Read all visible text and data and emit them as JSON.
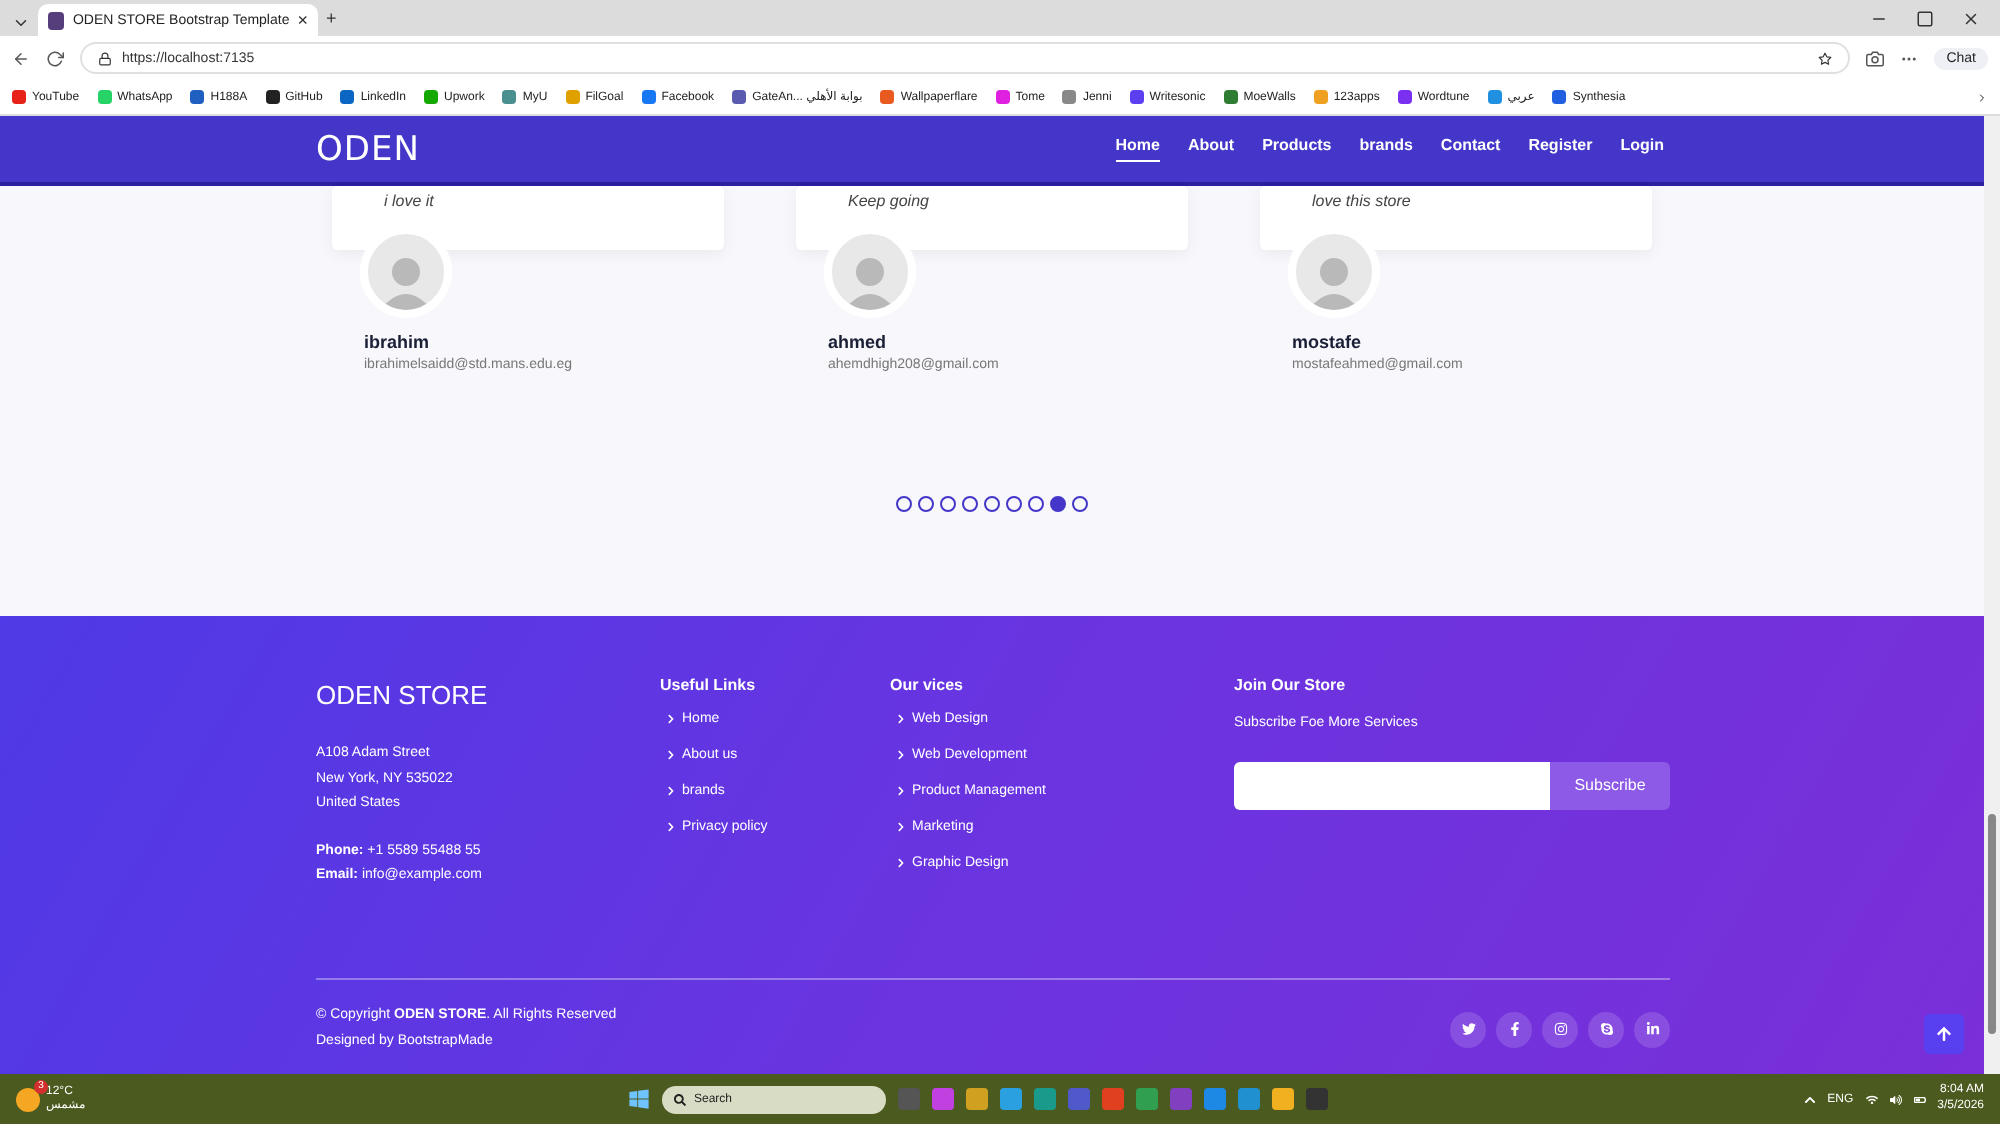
{
  "browser": {
    "tab": {
      "title": "ODEN STORE Bootstrap Template",
      "close": "×",
      "new_tab": "+"
    },
    "url": "https://localhost:7135",
    "chat": "Chat",
    "bookmarks": [
      {
        "label": "YouTube",
        "color": "#e62117"
      },
      {
        "label": "WhatsApp",
        "color": "#25d366"
      },
      {
        "label": "H188A",
        "color": "#1f5fbf"
      },
      {
        "label": "GitHub",
        "color": "#222222"
      },
      {
        "label": "LinkedIn",
        "color": "#0a66c2"
      },
      {
        "label": "Upwork",
        "color": "#14a800"
      },
      {
        "label": "MyU",
        "color": "#4a8f8f"
      },
      {
        "label": "FilGoal",
        "color": "#e0a000"
      },
      {
        "label": "Facebook",
        "color": "#1877f2"
      },
      {
        "label": "GateAn... بوابة الأهلي",
        "color": "#5a5ab0"
      },
      {
        "label": "Wallpaperflare",
        "color": "#e85a20"
      },
      {
        "label": "Tome",
        "color": "#e020e0"
      },
      {
        "label": "Jenni",
        "color": "#888888"
      },
      {
        "label": "Writesonic",
        "color": "#5b3ff0"
      },
      {
        "label": "MoeWalls",
        "color": "#2e7d32"
      },
      {
        "label": "123apps",
        "color": "#f0a020"
      },
      {
        "label": "Wordtune",
        "color": "#7b2ff0"
      },
      {
        "label": "عربي",
        "color": "#2090e0"
      },
      {
        "label": "Synthesia",
        "color": "#2060e0"
      }
    ]
  },
  "navbar": {
    "brand": "ODEN",
    "links": [
      {
        "label": "Home",
        "selected": true
      },
      {
        "label": "About",
        "selected": false
      },
      {
        "label": "Products",
        "selected": false
      },
      {
        "label": "brands",
        "selected": false
      },
      {
        "label": "Contact",
        "selected": false
      },
      {
        "label": "Register",
        "selected": false
      },
      {
        "label": "Login",
        "selected": false
      }
    ]
  },
  "testimonials": [
    {
      "quote": "i love it",
      "name": "ibrahim",
      "email": "ibrahimelsaidd@std.mans.edu.eg"
    },
    {
      "quote": "Keep going",
      "name": "ahmed",
      "email": "ahemdhigh208@gmail.com"
    },
    {
      "quote": "love this store",
      "name": "mostafe",
      "email": "mostafeahmed@gmail.com"
    }
  ],
  "carousel": {
    "dots": [
      {
        "selected": false
      },
      {
        "selected": false
      },
      {
        "selected": false
      },
      {
        "selected": false
      },
      {
        "selected": false
      },
      {
        "selected": false
      },
      {
        "selected": false
      },
      {
        "selected": true
      },
      {
        "selected": false
      }
    ]
  },
  "footer": {
    "brand": "ODEN STORE",
    "address": [
      "A108 Adam Street",
      "New York, NY 535022",
      "United States"
    ],
    "contacts": [
      "**Phone:** +1 5589 55488 55",
      "**Email:** info@example.com"
    ],
    "columns": [
      {
        "title": "Useful Links",
        "links": [
          "Home",
          "About us",
          "brands",
          "Privacy policy"
        ]
      },
      {
        "title": "Our vices",
        "links": [
          "Web Design",
          "Web Development",
          "Product Management",
          "Marketing",
          "Graphic Design"
        ]
      }
    ],
    "join": {
      "title": "Join Our Store",
      "text": "Subscribe Foe More Services",
      "button": "Subscribe"
    },
    "copyright": "© Copyright **ODEN STORE**. All Rights Reserved",
    "credits": "Designed by BootstrapMade",
    "social": [
      {
        "kind": "twitter"
      },
      {
        "kind": "facebook"
      },
      {
        "kind": "instagram"
      },
      {
        "kind": "skype"
      },
      {
        "kind": "linkedin"
      }
    ]
  },
  "taskbar": {
    "weather": {
      "temp": "12°C",
      "text": "مشمس",
      "badge": "3"
    },
    "search": "Search",
    "apps": [
      {
        "color": "#555555"
      },
      {
        "color": "#c040e0"
      },
      {
        "color": "#d0a020"
      },
      {
        "color": "#2aa0e0"
      },
      {
        "color": "#1a9a8a"
      },
      {
        "color": "#5059c9"
      },
      {
        "color": "#e04020"
      },
      {
        "color": "#30a050"
      },
      {
        "color": "#8040c0"
      },
      {
        "color": "#1e88e5"
      },
      {
        "color": "#2090d0"
      },
      {
        "color": "#f0b020"
      },
      {
        "color": "#333333"
      }
    ],
    "lang": "ENG",
    "time": "8:04 AM",
    "date": "3/5/2026"
  }
}
